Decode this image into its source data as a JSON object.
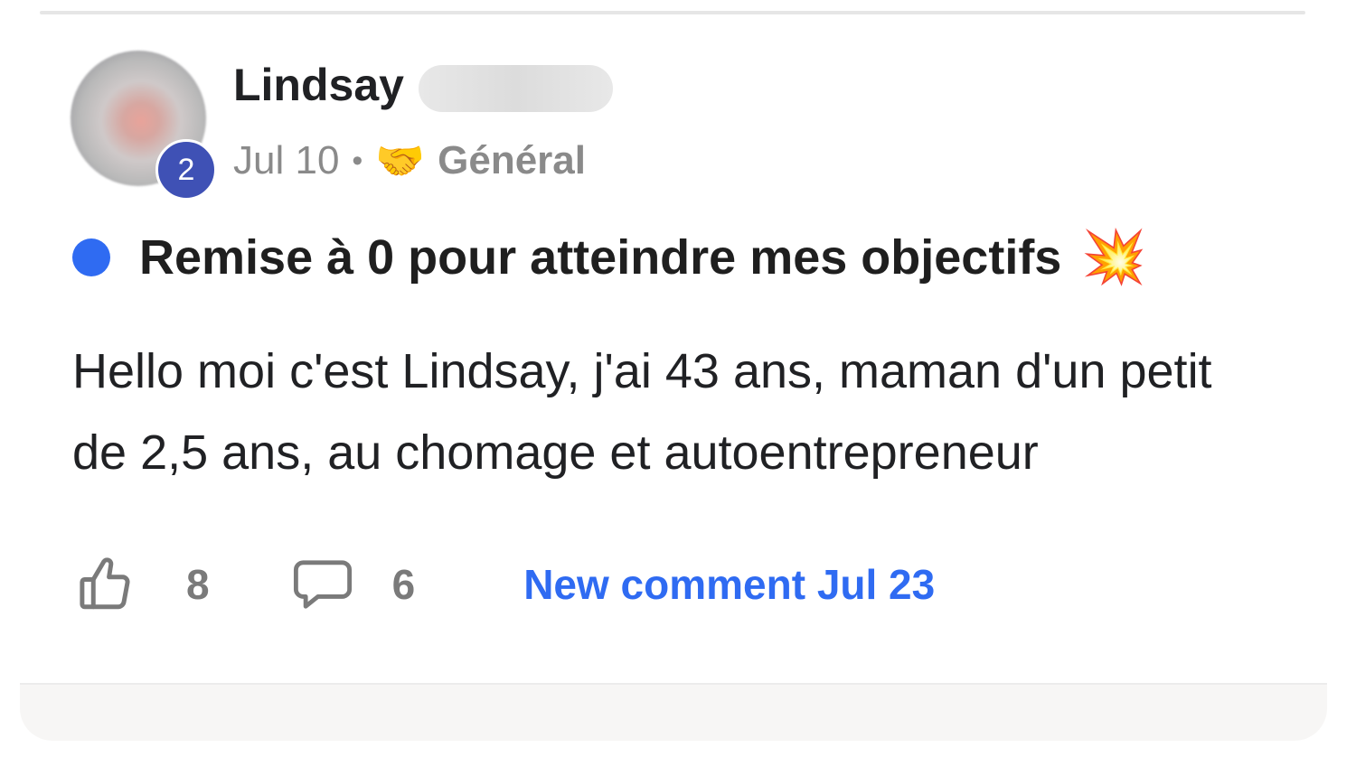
{
  "post": {
    "author": {
      "first_name": "Lindsay",
      "level_badge": "2"
    },
    "meta": {
      "date": "Jul 10",
      "separator": "•",
      "category_icon": "🤝",
      "category": "Général"
    },
    "title": "Remise à 0 pour atteindre mes objectifs",
    "title_emoji": "💥",
    "body": "Hello moi c'est Lindsay, j'ai 43 ans, maman d'un petit de 2,5 ans, au chomage et autoentrepreneur",
    "actions": {
      "likes": "8",
      "comments": "6",
      "new_comment": "New comment Jul 23"
    },
    "colors": {
      "unread_dot": "#2f6bf2",
      "link": "#2f6bf2",
      "badge": "#3f51b5"
    },
    "icons": {
      "like": "thumbs-up-icon",
      "comment": "comment-bubble-icon"
    }
  }
}
